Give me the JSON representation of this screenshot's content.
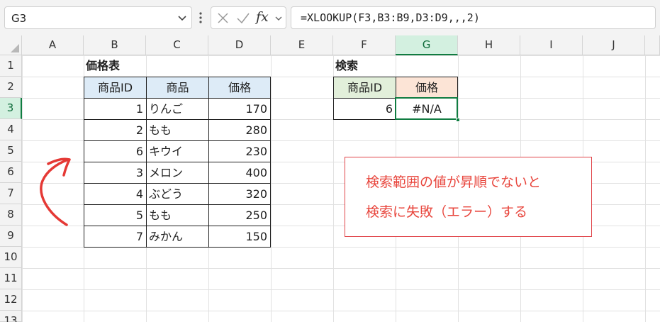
{
  "namebox": {
    "value": "G3"
  },
  "formula_bar": {
    "fx_label": "fx",
    "formula": "=XLOOKUP(F3,B3:B9,D3:D9,,,2)"
  },
  "columns": [
    "A",
    "B",
    "C",
    "D",
    "E",
    "F",
    "G",
    "H",
    "I",
    "J"
  ],
  "rows": [
    "1",
    "2",
    "3",
    "4",
    "5",
    "6",
    "7",
    "8",
    "9",
    "10",
    "11",
    "12",
    "13"
  ],
  "selected": {
    "column": "G",
    "row": "3"
  },
  "price_table": {
    "title": "価格表",
    "headers": [
      "商品ID",
      "商品",
      "価格"
    ],
    "rows": [
      {
        "id": "1",
        "name": "りんご",
        "price": "170"
      },
      {
        "id": "2",
        "name": "もも",
        "price": "280"
      },
      {
        "id": "6",
        "name": "キウイ",
        "price": "230"
      },
      {
        "id": "3",
        "name": "メロン",
        "price": "400"
      },
      {
        "id": "4",
        "name": "ぶどう",
        "price": "320"
      },
      {
        "id": "5",
        "name": "もも",
        "price": "250"
      },
      {
        "id": "7",
        "name": "みかん",
        "price": "150"
      }
    ]
  },
  "search": {
    "title": "検索",
    "headers": [
      "商品ID",
      "価格"
    ],
    "id_value": "6",
    "result": "#N/A"
  },
  "annotation": {
    "line1": "検索範囲の値が昇順でないと",
    "line2": "検索に失敗（エラー）する",
    "color": "#e8453c"
  },
  "colors": {
    "accent": "#107c41",
    "header_blue": "#ddebf7",
    "header_green": "#e2efda",
    "header_peach": "#fce4d6"
  }
}
